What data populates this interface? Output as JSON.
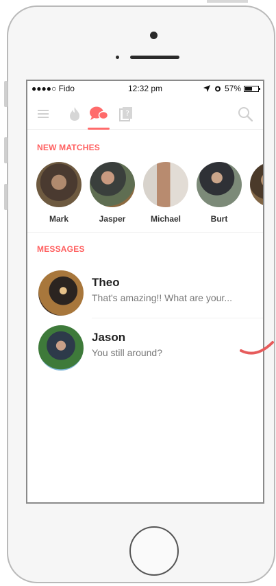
{
  "status_bar": {
    "carrier": "●●●●○ Fido",
    "time": "12:32 pm",
    "battery": "57%",
    "battery_level": 0.57
  },
  "nav": {
    "items": [
      {
        "icon": "menu-icon"
      },
      {
        "icon": "flame-icon"
      },
      {
        "icon": "chat-bubbles-icon",
        "active": true
      },
      {
        "icon": "card-icon"
      },
      {
        "icon": "search-icon"
      }
    ],
    "accent_color": "#ff5f5f"
  },
  "new_matches": {
    "title": "NEW MATCHES",
    "items": [
      {
        "name": "Mark"
      },
      {
        "name": "Jasper"
      },
      {
        "name": "Michael"
      },
      {
        "name": "Burt"
      },
      {
        "name": ""
      }
    ]
  },
  "messages": {
    "title": "MESSAGES",
    "items": [
      {
        "name": "Theo",
        "preview": "That's amazing!! What are your..."
      },
      {
        "name": "Jason",
        "preview": "You still around?"
      }
    ]
  }
}
